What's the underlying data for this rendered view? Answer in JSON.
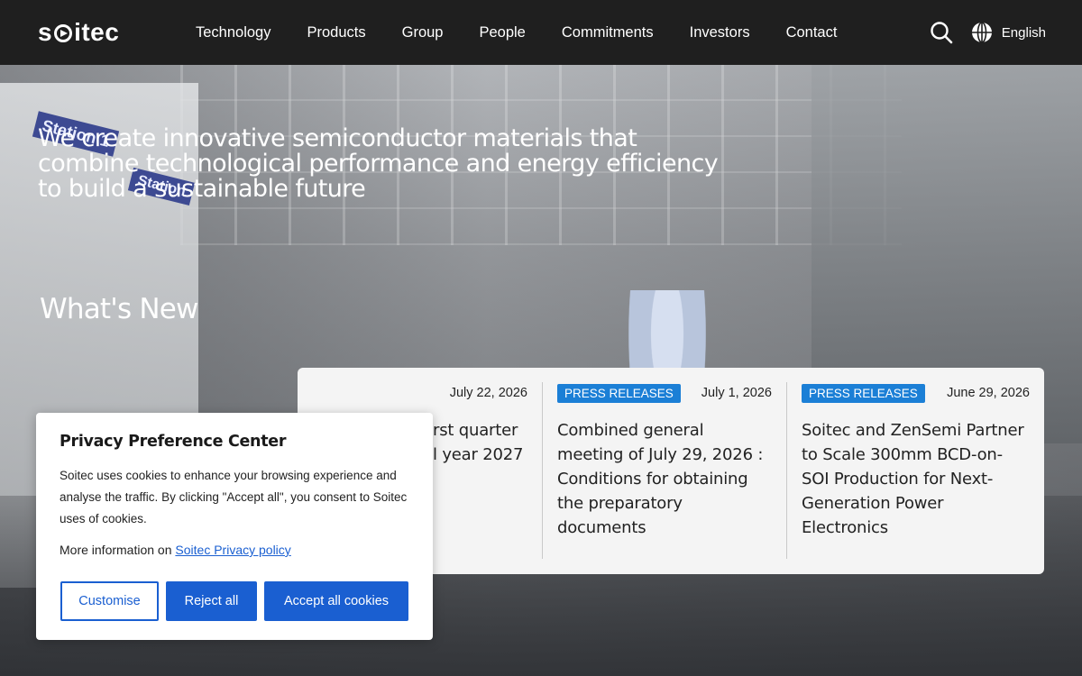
{
  "header": {
    "logo_text": "soitec",
    "nav": [
      "Technology",
      "Products",
      "Group",
      "People",
      "Commitments",
      "Investors",
      "Contact"
    ],
    "language": "English"
  },
  "hero": {
    "headline": "We create innovative semiconductor materials that combine technological performance and energy efficiency to build a sustainable future",
    "station_label_1": "Station 1",
    "station_label_2": "Station",
    "section_title": "What's New"
  },
  "news": [
    {
      "category": "",
      "date": "July 22, 2026",
      "title": "rst quarter\nl year 2027"
    },
    {
      "category": "PRESS RELEASES",
      "date": "July 1, 2026",
      "title": "Combined general meeting of July 29, 2026 : Conditions for obtaining the preparatory documents"
    },
    {
      "category": "PRESS RELEASES",
      "date": "June 29, 2026",
      "title": "Soitec and ZenSemi Partner to Scale 300mm BCD-on-SOI Production for Next-Generation Power Electronics"
    }
  ],
  "cookie": {
    "title": "Privacy Preference Center",
    "description": "Soitec uses cookies to enhance your browsing experience and analyse the traffic. By clicking \"Accept all\", you consent to Soitec uses of cookies.",
    "more_prefix": "More information on",
    "privacy_link": "Soitec Privacy policy",
    "customise": "Customise",
    "reject": "Reject all",
    "accept": "Accept all cookies"
  },
  "colors": {
    "header_bg": "#1f1f1f",
    "badge": "#1b7fd6",
    "primary_button": "#1a5fd1"
  }
}
